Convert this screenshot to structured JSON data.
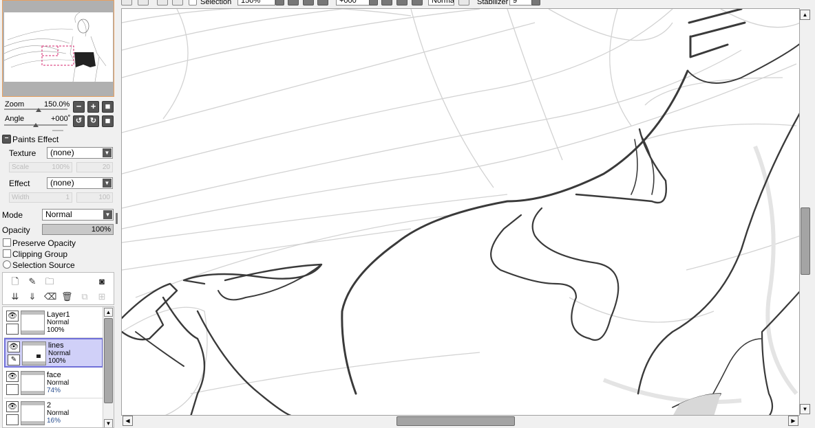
{
  "toolbar": {
    "selection_label": "Selection",
    "zoom_value": "150%",
    "rotation_value": "+000°",
    "blend_mode": "Normal",
    "stabilizer_label": "Stabilizer",
    "stabilizer_value": "9"
  },
  "navigator": {
    "zoom_label": "Zoom",
    "zoom_value": "150.0%",
    "angle_label": "Angle",
    "angle_value": "+000˚",
    "zoom_buttons": [
      "−",
      "+",
      "■"
    ],
    "angle_buttons": [
      "↺",
      "↻",
      "■"
    ]
  },
  "paints_effect": {
    "header": "Paints Effect",
    "texture_label": "Texture",
    "texture_value": "(none)",
    "scale_label": "Scale",
    "scale_value": "100%",
    "scale_value2": "20",
    "effect_label": "Effect",
    "effect_value": "(none)",
    "width_label": "Width",
    "width_value": "1",
    "width_value2": "100"
  },
  "layer_props": {
    "mode_label": "Mode",
    "mode_value": "Normal",
    "opacity_label": "Opacity",
    "opacity_value": "100%",
    "preserve_opacity": "Preserve Opacity",
    "clipping_group": "Clipping Group",
    "selection_source": "Selection Source"
  },
  "layers": [
    {
      "name": "Layer1",
      "mode": "Normal",
      "opacity": "100%",
      "selected": false
    },
    {
      "name": "lines",
      "mode": "Normal",
      "opacity": "100%",
      "selected": true
    },
    {
      "name": "face",
      "mode": "Normal",
      "opacity": "74%",
      "selected": false
    },
    {
      "name": "2",
      "mode": "Normal",
      "opacity": "16%",
      "selected": false
    }
  ],
  "icons": {
    "eye": "👁",
    "pen": "✎",
    "new_layer": "🗋",
    "folder": "🗀",
    "trash": "🗑"
  }
}
